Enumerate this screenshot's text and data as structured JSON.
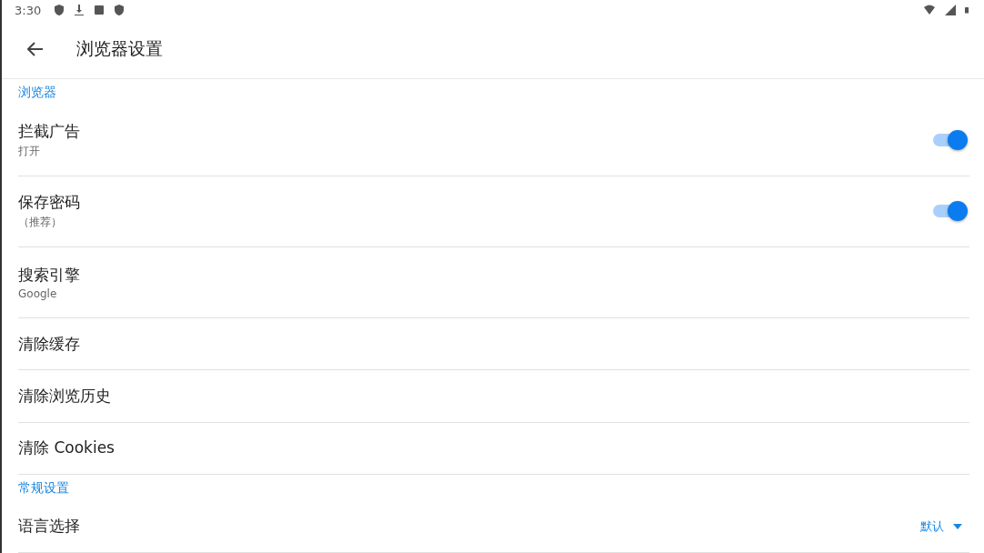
{
  "status_bar": {
    "time": "3:30"
  },
  "toolbar": {
    "title": "浏览器设置"
  },
  "sections": [
    {
      "header": "浏览器",
      "items": [
        {
          "kind": "toggle",
          "title": "拦截广告",
          "subtitle": "打开",
          "on": true
        },
        {
          "kind": "toggle",
          "title": "保存密码",
          "subtitle": "（推荐）",
          "on": true
        },
        {
          "kind": "text",
          "title": "搜索引擎",
          "subtitle": "Google"
        },
        {
          "kind": "text",
          "title": "清除缓存"
        },
        {
          "kind": "text",
          "title": "清除浏览历史"
        },
        {
          "kind": "text",
          "title": "清除 Cookies"
        }
      ]
    },
    {
      "header": "常规设置",
      "items": [
        {
          "kind": "select",
          "title": "语言选择",
          "value": "默认"
        }
      ]
    }
  ]
}
